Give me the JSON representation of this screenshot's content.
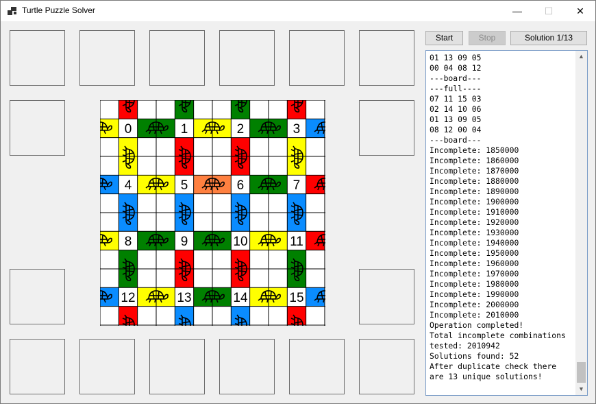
{
  "window": {
    "title": "Turtle Puzzle Solver",
    "minimize_glyph": "—",
    "maximize_glyph": "☐",
    "close_glyph": "✕"
  },
  "toolbar": {
    "start_label": "Start",
    "stop_label": "Stop",
    "solution_label": "Solution 1/13"
  },
  "colors": {
    "red": "#ff0000",
    "green": "#008000",
    "yellow": "#ffff00",
    "blue": "#0a8cff",
    "orange": "#ff8040",
    "white": "#ffffff"
  },
  "board": {
    "tile_numbers": [
      "0",
      "1",
      "2",
      "3",
      "4",
      "5",
      "6",
      "7",
      "8",
      "9",
      "10",
      "11",
      "12",
      "13",
      "14",
      "15"
    ]
  },
  "log": {
    "lines": [
      "01 13 09 05",
      "00 04 08 12",
      "---board---",
      "---full----",
      "07 11 15 03",
      "02 14 10 06",
      "01 13 09 05",
      "08 12 00 04",
      "---board---",
      "Incomplete: 1850000",
      "Incomplete: 1860000",
      "Incomplete: 1870000",
      "Incomplete: 1880000",
      "Incomplete: 1890000",
      "Incomplete: 1900000",
      "Incomplete: 1910000",
      "Incomplete: 1920000",
      "Incomplete: 1930000",
      "Incomplete: 1940000",
      "Incomplete: 1950000",
      "Incomplete: 1960000",
      "Incomplete: 1970000",
      "Incomplete: 1980000",
      "Incomplete: 1990000",
      "Incomplete: 2000000",
      "Incomplete: 2010000",
      "Operation completed!",
      "Total incomplete combinations",
      "tested: 2010942",
      "Solutions found: 52",
      "After duplicate check there",
      "are 13 unique solutions!"
    ]
  }
}
